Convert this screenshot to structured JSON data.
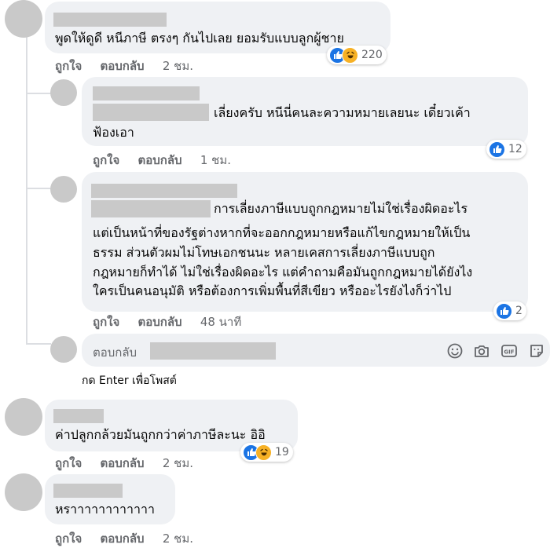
{
  "comments": [
    {
      "text_lines": [
        "พูดให้ดูดี หนีภาษี ตรงๆ กันไปเลย ยอมรับแบบลูกผู้ชาย"
      ],
      "like_label": "ถูกใจ",
      "reply_label": "ตอบกลับ",
      "time": "2 ชม.",
      "reaction_count": "220",
      "reaction_icons": [
        "like-icon",
        "haha-icon"
      ]
    },
    {
      "text_lines": [
        "เลี่ยงครับ หนีนี่คนละความหมายเลยนะ เดี๋ยวเค้า",
        "ฟ้องเอา"
      ],
      "like_label": "ถูกใจ",
      "reply_label": "ตอบกลับ",
      "time": "1 ชม.",
      "reaction_count": "12",
      "reaction_icons": [
        "like-icon"
      ]
    },
    {
      "text_lines": [
        "การเลี่ยงภาษีแบบถูกกฎหมายไม่ใช่เรื่องผิดอะไร",
        "แต่เป็นหน้าที่ของรัฐต่างหากที่จะออกกฎหมายหรือแก้ไขกฎหมายให้เป็น",
        "ธรรม ส่วนตัวผมไม่โทษเอกชนนะ หลายเคสการเลี่ยงภาษีแบบถูก",
        "กฎหมายก็ทำได้ ไม่ใช่เรื่องผิดอะไร แต่คำถามคือมันถูกกฎหมายได้ยังไง",
        "ใครเป็นคนอนุมัติ หรือต้องการเพิ่มพื้นที่สีเขียว หรืออะไรยังไงก็ว่าไป"
      ],
      "like_label": "ถูกใจ",
      "reply_label": "ตอบกลับ",
      "time": "48 นาที",
      "reaction_count": "2",
      "reaction_icons": [
        "like-icon"
      ]
    },
    {
      "text_lines": [
        "ค่าปลูกกล้วยมันถูกกว่าค่าภาษีละนะ อิอิ"
      ],
      "like_label": "ถูกใจ",
      "reply_label": "ตอบกลับ",
      "time": "2 ชม.",
      "reaction_count": "19",
      "reaction_icons": [
        "like-icon",
        "haha-icon"
      ]
    },
    {
      "text_lines": [
        "หราาาาาาาาาาาา"
      ],
      "like_label": "ถูกใจ",
      "reply_label": "ตอบกลับ",
      "time": "2 ชม."
    }
  ],
  "reply_box": {
    "label": "ตอบกลับ",
    "hint": "กด Enter เพื่อโพสต์",
    "tool_icons": [
      "emoji-icon",
      "camera-icon",
      "gif-icon",
      "sticker-icon"
    ]
  },
  "colors": {
    "bubble": "#eff1f4",
    "redaction": "#c9c9c9",
    "meta_text": "#65676b",
    "like_blue": "#1b74e4",
    "haha_yellow": "#f7b125"
  }
}
